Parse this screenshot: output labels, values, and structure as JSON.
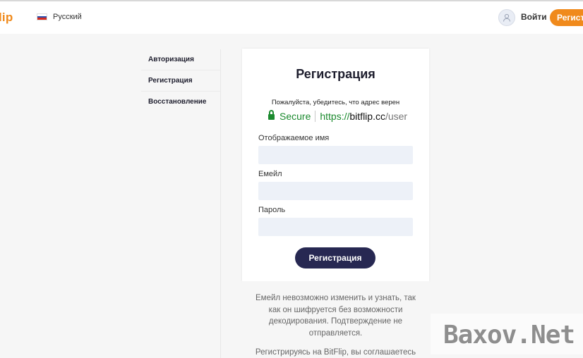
{
  "header": {
    "logo_text": "lip",
    "language": "Русский",
    "login_label": "Войти",
    "register_label": "Регистрация",
    "accent_color": "#f08a1c"
  },
  "sidebar": {
    "items": [
      {
        "label": "Авторизация"
      },
      {
        "label": "Регистрация"
      },
      {
        "label": "Восстановление"
      }
    ]
  },
  "form": {
    "title": "Регистрация",
    "notice": "Пожалуйста, убедитесь, что адрес верен",
    "secure_label": "Secure",
    "url_scheme": "https://",
    "url_host": "bitflip.cc",
    "url_path": "/user",
    "fields": [
      {
        "label": "Отображаемое имя",
        "value": ""
      },
      {
        "label": "Емейл",
        "value": ""
      },
      {
        "label": "Пароль",
        "value": ""
      }
    ],
    "submit_label": "Регистрация",
    "button_color": "#272852"
  },
  "info": {
    "text1": "Емейл невозможно изменить и узнать, так как он шифруется без возможности декодирования. Подтверждение не отправляется.",
    "text2": "Регистрируясь на BitFlip, вы соглашаетесь с"
  },
  "watermark": {
    "text": "Baxov.Net"
  }
}
